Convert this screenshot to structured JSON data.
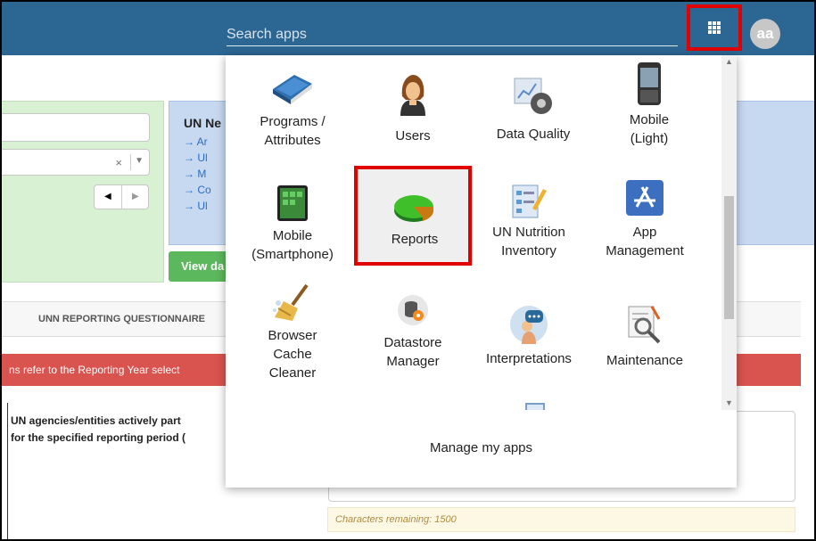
{
  "header": {
    "search_placeholder": "Search apps",
    "avatar_initials": "aa",
    "bg_color": "#2c6693"
  },
  "apps_menu": {
    "items": [
      {
        "label": "Programs / Attributes",
        "icon": "book-icon"
      },
      {
        "label": "Users",
        "icon": "user-icon"
      },
      {
        "label": "Data Quality",
        "icon": "chart-gear-icon"
      },
      {
        "label": "Mobile (Light)",
        "icon": "phone-icon"
      },
      {
        "label": "Mobile (Smartphone)",
        "icon": "tablet-icon"
      },
      {
        "label": "Reports",
        "icon": "pie-chart-icon"
      },
      {
        "label": "UN Nutrition Inventory",
        "icon": "checklist-icon"
      },
      {
        "label": "App Management",
        "icon": "app-store-icon"
      },
      {
        "label": "Browser Cache Cleaner",
        "icon": "broom-icon"
      },
      {
        "label": "Datastore Manager",
        "icon": "database-gear-icon"
      },
      {
        "label": "Interpretations",
        "icon": "chat-user-icon"
      },
      {
        "label": "Maintenance",
        "icon": "magnifier-doc-icon"
      }
    ],
    "manage_label": "Manage my apps"
  },
  "background": {
    "blue_panel_title": "UN Ne",
    "blue_panel_links": [
      "→ Ar",
      "→ Ul",
      "→ M",
      "→ Co",
      "→ Ul"
    ],
    "clear_glyph": "×",
    "view_button": "View da",
    "tab_label": "UNN REPORTING QUESTIONNAIRE",
    "banner_text": "ns refer to the Reporting Year select",
    "question_line1": "UN agencies/entities actively part",
    "question_line2": "for the specified reporting period (",
    "chars_remaining": "Characters remaining: 1500"
  }
}
